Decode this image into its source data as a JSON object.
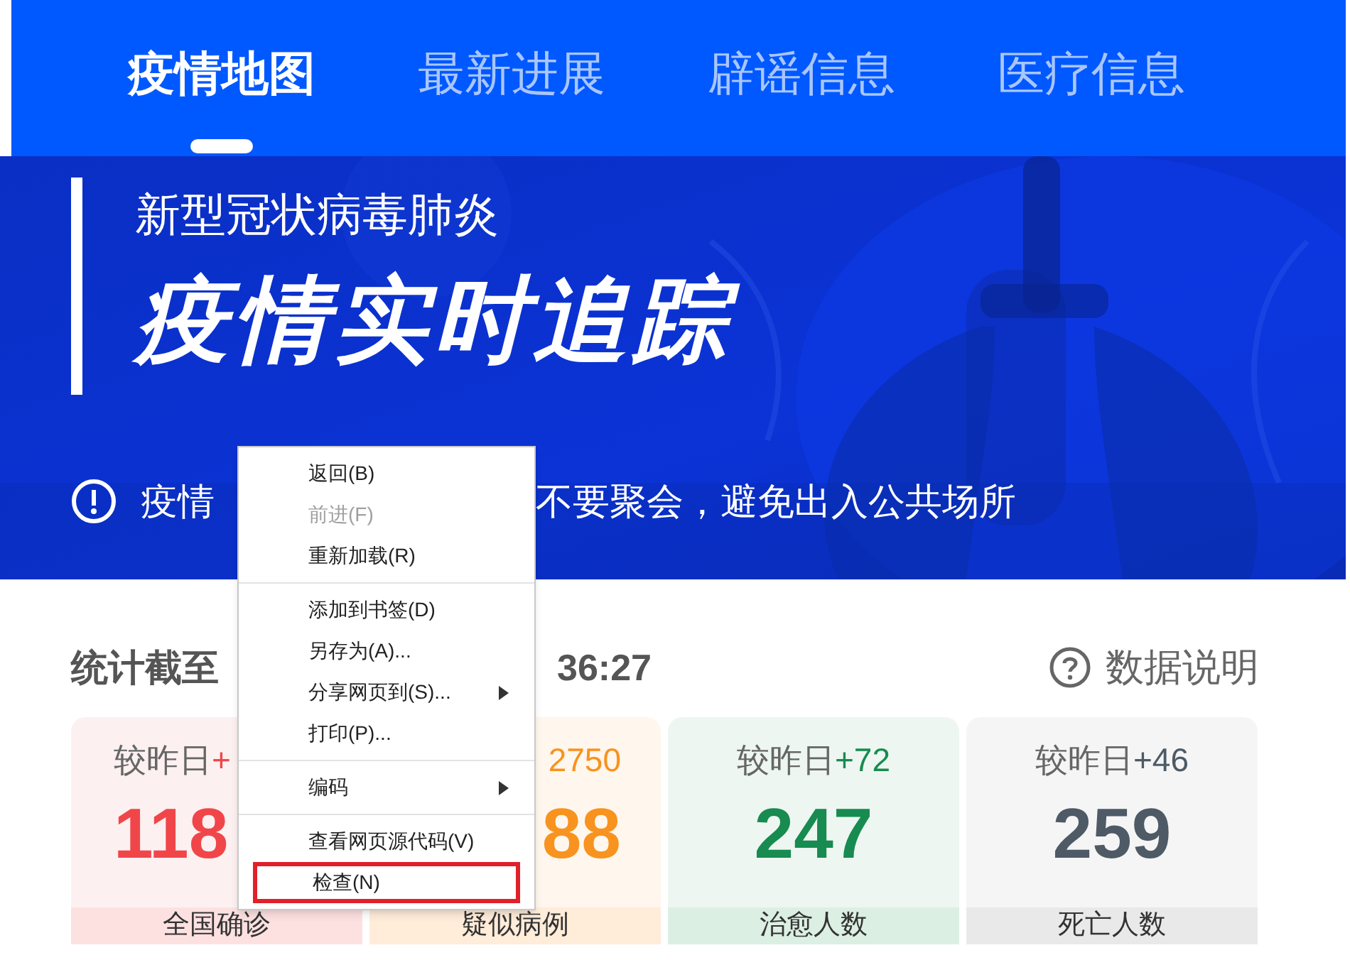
{
  "tabs": [
    {
      "label": "疫情地图",
      "selected": true
    },
    {
      "label": "最新进展",
      "selected": false
    },
    {
      "label": "辟谣信息",
      "selected": false
    },
    {
      "label": "医疗信息",
      "selected": false
    }
  ],
  "banner": {
    "kind": "picture",
    "subtitle": "新型冠状病毒肺炎",
    "title": "疫情实时追踪",
    "notice_start": "疫情",
    "notice_end": "不要聚会，避免出入公共场所"
  },
  "stats": {
    "as_of_start": "统计截至",
    "as_of_end": "36:27",
    "help": "数据说明"
  },
  "cards": [
    {
      "delta_label": "较昨日",
      "delta": "+",
      "number": "118",
      "label": "全国确诊",
      "color": "#f0464a"
    },
    {
      "delta": "2750",
      "number": "88",
      "label": "疑似病例",
      "color": "#f7931e"
    },
    {
      "delta_label": "较昨日",
      "delta": "+72",
      "number": "247",
      "label": "治愈人数",
      "color": "#178b50"
    },
    {
      "delta_label": "较昨日",
      "delta": "+46",
      "number": "259",
      "label": "死亡人数",
      "color": "#4e5a65"
    }
  ],
  "context_menu": {
    "groups": [
      [
        {
          "label": "返回(B)",
          "disabled": false,
          "submenu": false,
          "highlighted": false
        },
        {
          "label": "前进(F)",
          "disabled": true,
          "submenu": false,
          "highlighted": false
        },
        {
          "label": "重新加载(R)",
          "disabled": false,
          "submenu": false,
          "highlighted": false
        }
      ],
      [
        {
          "label": "添加到书签(D)",
          "disabled": false,
          "submenu": false,
          "highlighted": false
        },
        {
          "label": "另存为(A)...",
          "disabled": false,
          "submenu": false,
          "highlighted": false
        },
        {
          "label": "分享网页到(S)...",
          "disabled": false,
          "submenu": true,
          "highlighted": false
        },
        {
          "label": "打印(P)...",
          "disabled": false,
          "submenu": false,
          "highlighted": false
        }
      ],
      [
        {
          "label": "编码",
          "disabled": false,
          "submenu": true,
          "highlighted": false
        }
      ],
      [
        {
          "label": "查看网页源代码(V)",
          "disabled": false,
          "submenu": false,
          "highlighted": false
        },
        {
          "label": "检查(N)",
          "disabled": false,
          "submenu": false,
          "highlighted": true
        }
      ]
    ]
  }
}
